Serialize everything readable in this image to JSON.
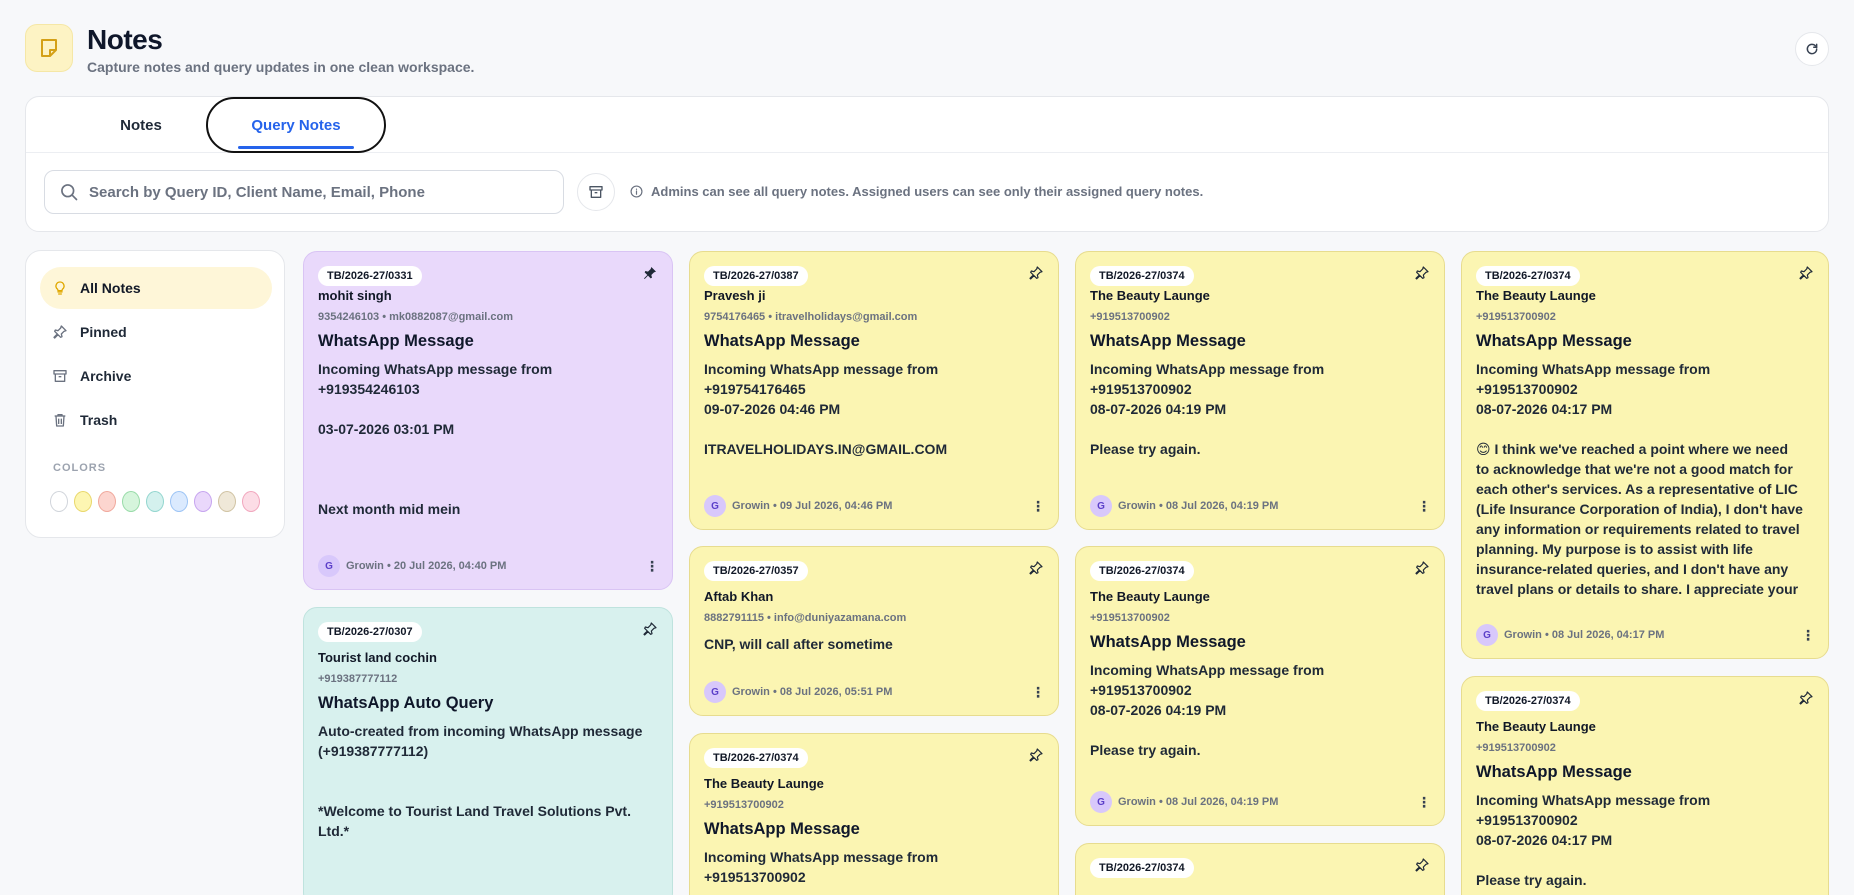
{
  "header": {
    "title": "Notes",
    "subtitle": "Capture notes and query updates in one clean workspace."
  },
  "tabs": [
    {
      "label": "Notes",
      "active": false
    },
    {
      "label": "Query Notes",
      "active": true
    }
  ],
  "search": {
    "placeholder": "Search by Query ID, Client Name, Email, Phone",
    "value": ""
  },
  "info": "Admins can see all query notes. Assigned users can see only their assigned query notes.",
  "sidebar": {
    "items": [
      {
        "label": "All Notes",
        "icon": "bulb-icon",
        "active": true
      },
      {
        "label": "Pinned",
        "icon": "pin-icon",
        "active": false
      },
      {
        "label": "Archive",
        "icon": "archive-icon",
        "active": false
      },
      {
        "label": "Trash",
        "icon": "trash-icon",
        "active": false
      }
    ],
    "colors_label": "COLORS",
    "colors": [
      "#ffffff",
      "#fdf6b2",
      "#fcd5cf",
      "#d6f5dc",
      "#d4f1ee",
      "#dbeafe",
      "#ead8fb",
      "#efe8d8",
      "#fcdde6"
    ]
  },
  "cards": [
    {
      "id": "TB/2026-27/0331",
      "client": "mohit singh",
      "contact": "9354246103 • mk0882087@gmail.com",
      "title": "WhatsApp Message",
      "body": "Incoming WhatsApp message from\n+919354246103\n\n03-07-2026 03:01 PM\n\n\n\nNext month mid mein",
      "footer": "Growin • 20 Jul 2026, 04:40 PM",
      "avatar": "G",
      "color": "purple",
      "pinned": true
    },
    {
      "id": "TB/2026-27/0307",
      "client": "Tourist land cochin",
      "contact": "+919387777112",
      "title": "WhatsApp Auto Query",
      "body": "Auto-created from incoming WhatsApp message\n(+919387777112)\n\n\n*Welcome to Tourist Land Travel Solutions Pvt.\nLtd.*",
      "footer": "",
      "avatar": "",
      "color": "teal",
      "pinned": false
    },
    {
      "id": "TB/2026-27/0387",
      "client": "Pravesh ji",
      "contact": "9754176465 • itravelholidays@gmail.com",
      "title": "WhatsApp Message",
      "body": "Incoming WhatsApp message from\n+919754176465\n09-07-2026 04:46 PM\n\nITRAVELHOLIDAYS.IN@GMAIL.COM",
      "footer": "Growin • 09 Jul 2026, 04:46 PM",
      "avatar": "G",
      "color": "yellow",
      "pinned": false
    },
    {
      "id": "TB/2026-27/0357",
      "client": "Aftab Khan",
      "contact": "8882791115 • info@duniyazamana.com",
      "title": "",
      "body": "CNP, will call after sometime",
      "footer": "Growin • 08 Jul 2026, 05:51 PM",
      "avatar": "G",
      "color": "yellow",
      "pinned": false
    },
    {
      "id": "TB/2026-27/0374",
      "client": "The Beauty Launge",
      "contact": "+919513700902",
      "title": "WhatsApp Message",
      "body": "Incoming WhatsApp message from\n+919513700902",
      "footer": "",
      "avatar": "",
      "color": "yellow",
      "pinned": false
    },
    {
      "id": "TB/2026-27/0374",
      "client": "The Beauty Launge",
      "contact": "+919513700902",
      "title": "WhatsApp Message",
      "body": "Incoming WhatsApp message from\n+919513700902\n08-07-2026 04:19 PM\n\nPlease try again.",
      "footer": "Growin • 08 Jul 2026, 04:19 PM",
      "avatar": "G",
      "color": "yellow",
      "pinned": false
    },
    {
      "id": "TB/2026-27/0374",
      "client": "The Beauty Launge",
      "contact": "+919513700902",
      "title": "WhatsApp Message",
      "body": "Incoming WhatsApp message from\n+919513700902\n08-07-2026 04:19 PM\n\nPlease try again.",
      "footer": "Growin • 08 Jul 2026, 04:19 PM",
      "avatar": "G",
      "color": "yellow",
      "pinned": false
    },
    {
      "id": "TB/2026-27/0374",
      "client": "",
      "contact": "",
      "title": "",
      "body": "",
      "footer": "",
      "avatar": "",
      "color": "yellow",
      "pinned": false
    },
    {
      "id": "TB/2026-27/0374",
      "client": "The Beauty Launge",
      "contact": "+919513700902",
      "title": "WhatsApp Message",
      "body": "Incoming WhatsApp message from\n+919513700902\n08-07-2026 04:17 PM\n\n😊 I think we've reached a point where we need\nto acknowledge that we're not a good match for\neach other's services. As a representative of LIC\n(Life Insurance Corporation of India), I don't have\nany information or requirements related to travel\nplanning. My purpose is to assist with life\ninsurance-related queries, and I don't have any\ntravel plans or details to share. I appreciate your",
      "footer": "Growin • 08 Jul 2026, 04:17 PM",
      "avatar": "G",
      "color": "yellow",
      "pinned": false
    },
    {
      "id": "TB/2026-27/0374",
      "client": "The Beauty Launge",
      "contact": "+919513700902",
      "title": "WhatsApp Message",
      "body": "Incoming WhatsApp message from\n+919513700902\n08-07-2026 04:17 PM\n\nPlease try again.",
      "footer": "",
      "avatar": "",
      "color": "yellow",
      "pinned": false
    }
  ]
}
